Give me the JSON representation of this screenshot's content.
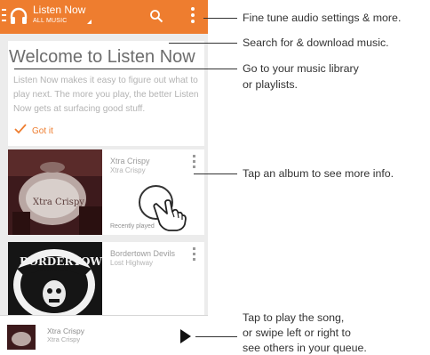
{
  "header": {
    "title": "Listen Now",
    "subtitle": "ALL MUSIC"
  },
  "welcome": {
    "heading": "Welcome to Listen Now",
    "body": "Listen Now makes it easy to figure out what to play next. The more you play, the better Listen Now gets at surfacing good stuff.",
    "action": "Got it"
  },
  "cards": [
    {
      "title": "Xtra Crispy",
      "artist": "Xtra Crispy",
      "reason": "Recently played",
      "art_text": "Xtra Crispy"
    },
    {
      "title": "Bordertown Devils",
      "artist": "Lost Highway",
      "art_text": "BORDERTOWN"
    }
  ],
  "now_playing": {
    "title": "Xtra Crispy",
    "artist": "Xtra Crispy"
  },
  "callouts": {
    "settings": "Fine tune audio settings & more.",
    "search": "Search for & download music.",
    "library_line1": "Go to your music library",
    "library_line2": "or playlists.",
    "album": "Tap an album to see more info.",
    "play_line1": "Tap to play the song,",
    "play_line2": "or swipe left or right to",
    "play_line3": "see others in your queue."
  },
  "colors": {
    "accent": "#ee7d2f",
    "background": "#ececec"
  },
  "icons": [
    "menu-icon",
    "headphones-icon",
    "dropdown-icon",
    "search-icon",
    "overflow-menu-icon",
    "check-icon",
    "tap-hand-icon",
    "play-icon"
  ]
}
